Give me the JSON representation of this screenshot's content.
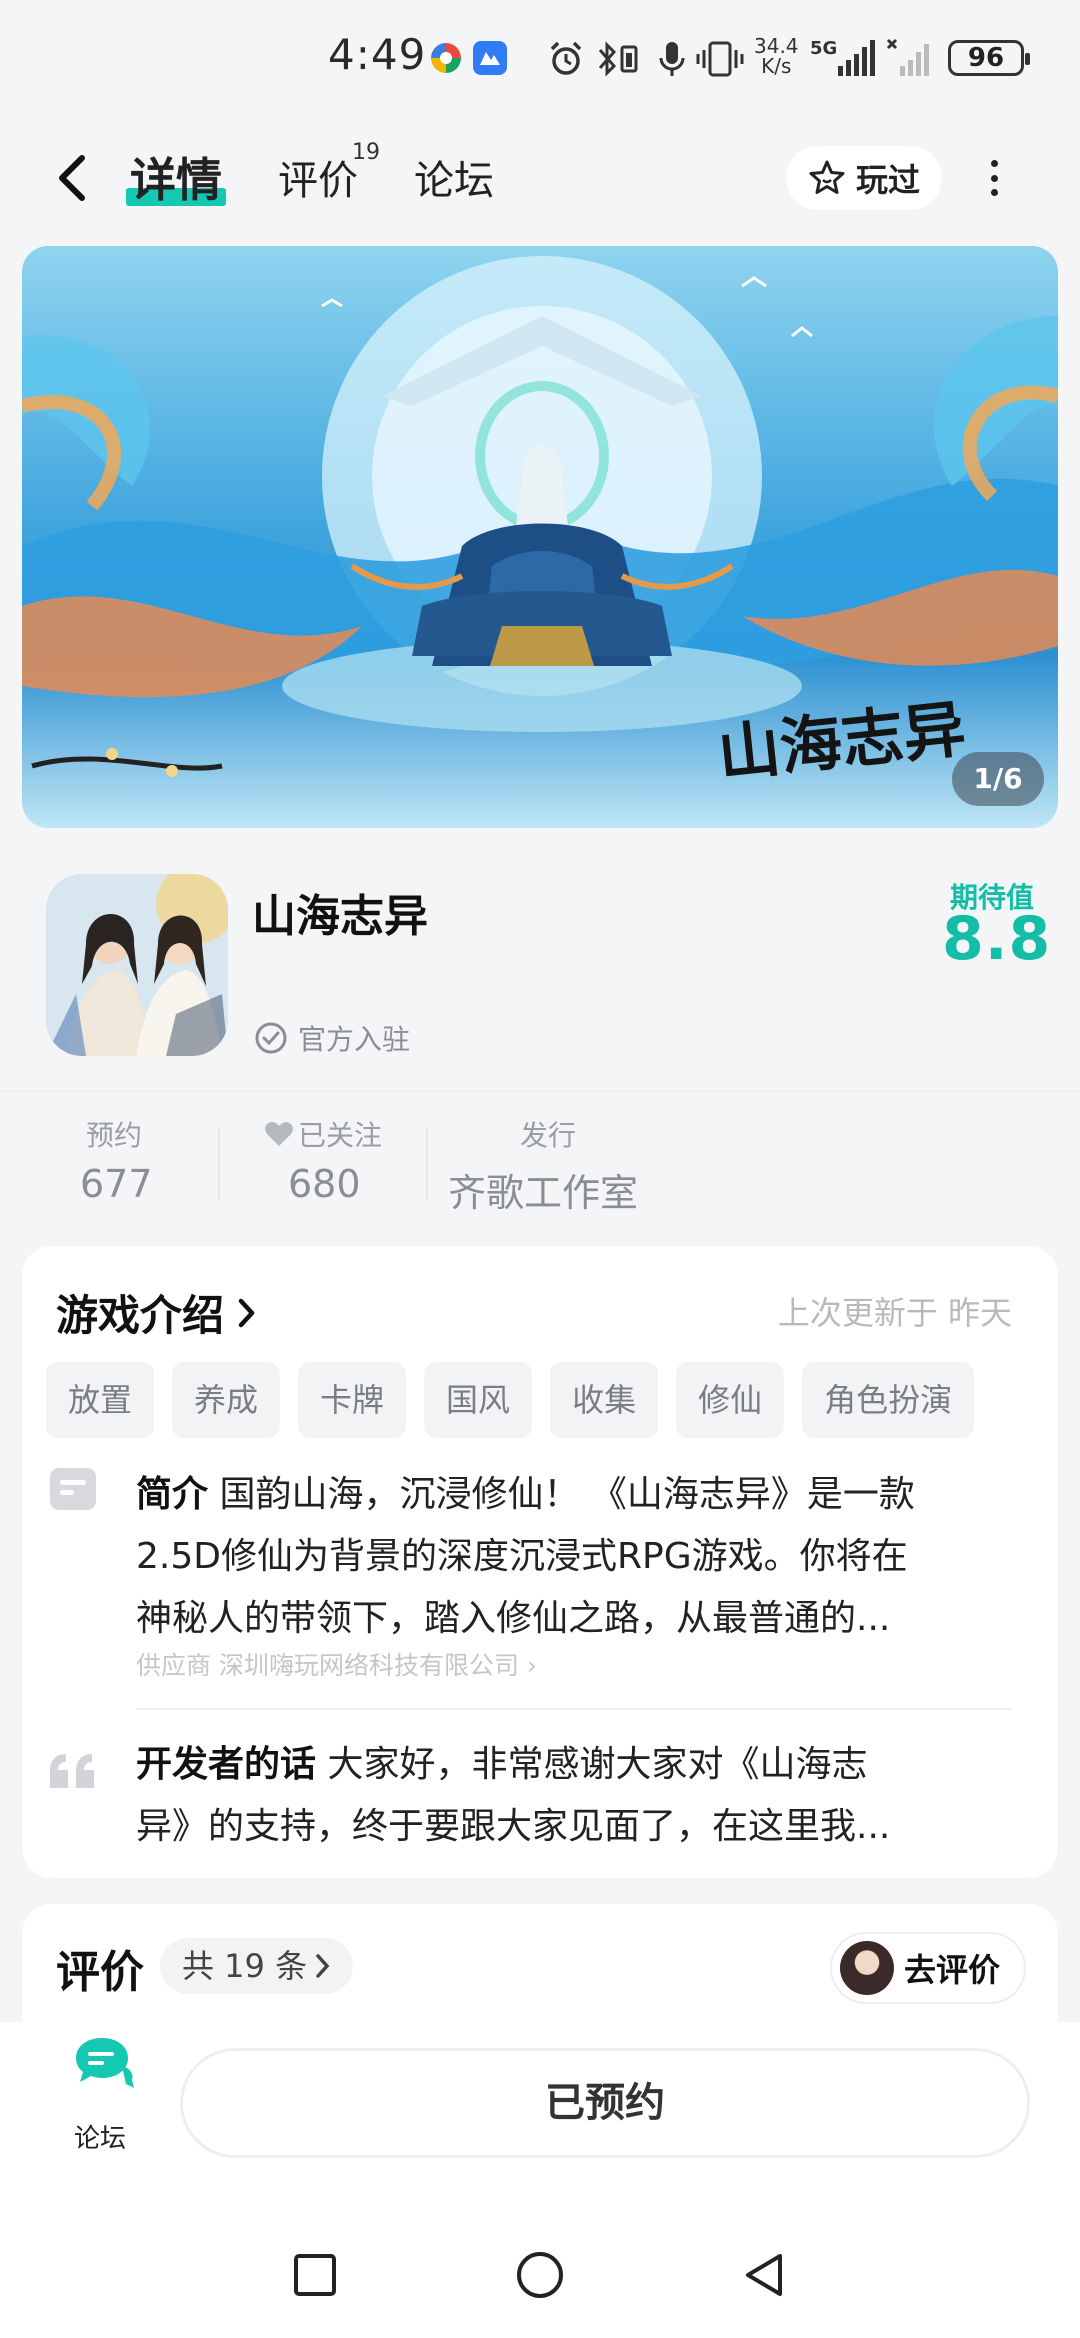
{
  "status_bar": {
    "time": "4:49",
    "net_speed_value": "34.4",
    "net_speed_unit": "K/s",
    "network": "5G",
    "battery": "96"
  },
  "nav": {
    "back_icon": "back-arrow-icon",
    "tabs": [
      {
        "label": "详情",
        "active": true
      },
      {
        "label": "评价",
        "badge": "19"
      },
      {
        "label": "论坛"
      }
    ],
    "played_label": "玩过",
    "more_icon": "more-vertical-icon"
  },
  "banner": {
    "counter": "1/6",
    "logo_text": "山海志异"
  },
  "app": {
    "name": "山海志异",
    "official_label": "官方入驻",
    "expect_label": "期待值",
    "expect_value": "8.8"
  },
  "stats": {
    "reserve_label": "预约",
    "reserve_value": "677",
    "follow_label": "已关注",
    "follow_value": "680",
    "publisher_label": "发行",
    "publisher_value": "齐歌工作室"
  },
  "intro": {
    "title": "游戏介绍",
    "updated": "上次更新于 昨天",
    "tags": [
      "放置",
      "养成",
      "卡牌",
      "国风",
      "收集",
      "修仙",
      "角色扮演"
    ],
    "summary_label": "简介",
    "summary_line1": " 国韵山海，沉浸修仙！ 《山海志异》是一款",
    "summary_line2": "2.5D修仙为背景的深度沉浸式RPG游戏。你将在",
    "summary_line3": "神秘人的带领下，踏入修仙之路，从最普通的...",
    "supplier": "供应商 深圳嗨玩网络科技有限公司 ›",
    "dev_label": "开发者的话",
    "dev_line1": " 大家好，非常感谢大家对《山海志",
    "dev_line2": "异》的支持，终于要跟大家见面了，在这里我..."
  },
  "review": {
    "title": "评价",
    "count": "共 19 条",
    "button": "去评价"
  },
  "bottom": {
    "forum_label": "论坛",
    "reserved_label": "已预约"
  },
  "colors": {
    "accent": "#14c8b2",
    "page_bg": "#f4f5f7"
  }
}
